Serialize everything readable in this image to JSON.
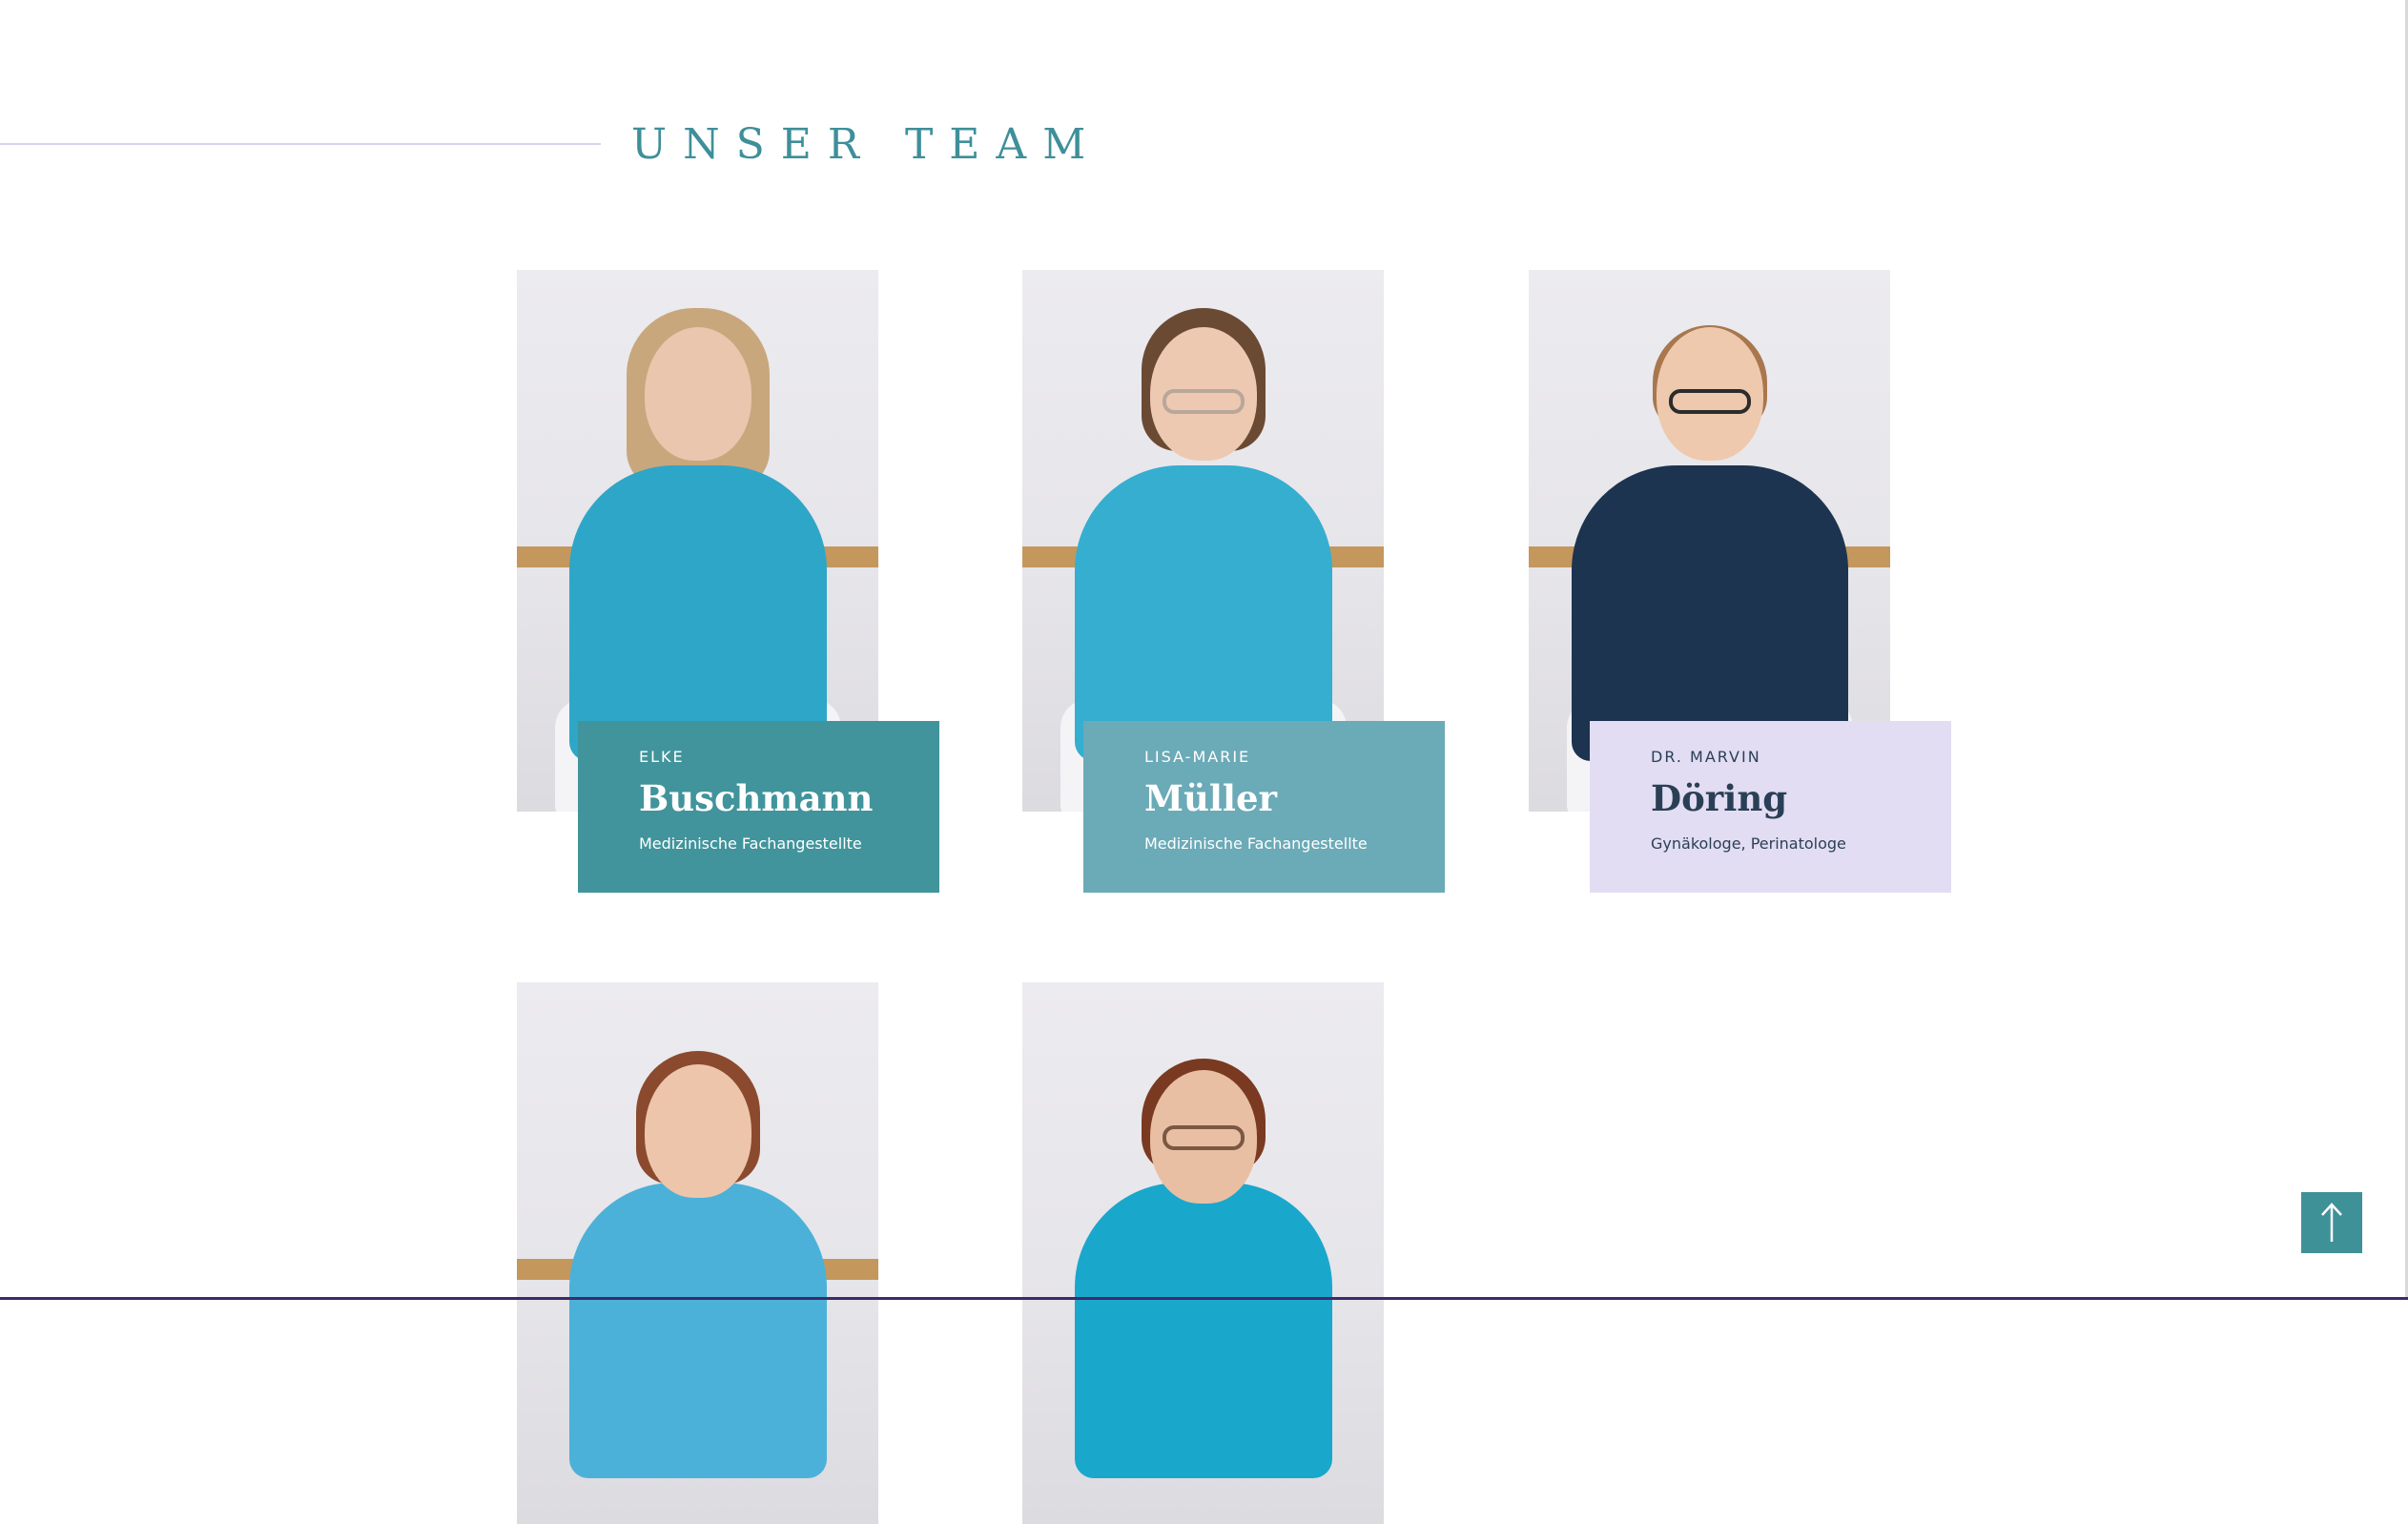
{
  "section": {
    "title": "UNSER TEAM"
  },
  "colors": {
    "accent": "#3e8f99",
    "card_teal_dark": "#41949b",
    "card_teal_light": "#6baab7",
    "card_lavender": "#e2ddf3",
    "rule": "#d8d3ee"
  },
  "team": [
    {
      "first_name": "ELKE",
      "last_name": "Buschmann",
      "role": "Medizinische Fachangestellte",
      "card_color": "#41949b",
      "text_color": "#ffffff"
    },
    {
      "first_name": "LISA-MARIE",
      "last_name": "Müller",
      "role": "Medizinische Fachangestellte",
      "card_color": "#6baab7",
      "text_color": "#ffffff"
    },
    {
      "first_name": "DR. MARVIN",
      "last_name": "Döring",
      "role": "Gynäkologe, Perinatologe",
      "card_color": "#e2ddf3",
      "text_color": "#2a3f55"
    }
  ],
  "scroll_top": {
    "icon": "arrow-up-icon"
  }
}
